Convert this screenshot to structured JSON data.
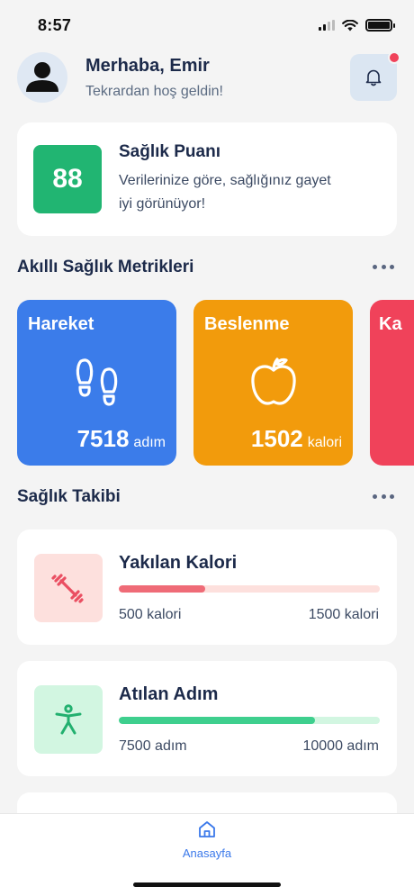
{
  "status_bar": {
    "time": "8:57"
  },
  "header": {
    "greeting": "Merhaba, Emir",
    "subtitle": "Tekrardan hoş geldin!",
    "avatar_icon": "user-icon",
    "notification_icon": "bell-icon",
    "has_notification": true
  },
  "health_score": {
    "value": "88",
    "title": "Sağlık Puanı",
    "description_line1": "Verilerinize göre, sağlığınız gayet",
    "description_line2": "iyi görünüyor!",
    "color": "#21b572"
  },
  "metrics_section": {
    "title": "Akıllı Sağlık Metrikleri",
    "more_icon": "more-horizontal-icon",
    "cards": [
      {
        "title": "Hareket",
        "icon": "footprints-icon",
        "value": "7518",
        "unit": "adım",
        "color": "#3b7cea"
      },
      {
        "title": "Beslenme",
        "icon": "apple-icon",
        "value": "1502",
        "unit": "kalori",
        "color": "#f29b0c"
      },
      {
        "title": "Ka",
        "icon": "",
        "value": "",
        "unit": "",
        "color": "#f0425a"
      }
    ]
  },
  "tracking_section": {
    "title": "Sağlık Takibi",
    "more_icon": "more-horizontal-icon",
    "items": [
      {
        "title": "Yakılan Kalori",
        "icon": "dumbbell-icon",
        "current": "500 kalori",
        "goal": "1500 kalori",
        "progress": 0.33,
        "color": "#ef6b77",
        "track_color": "#fde0dd",
        "icon_bg": "#fde0dd"
      },
      {
        "title": "Atılan Adım",
        "icon": "person-icon",
        "current": "7500 adım",
        "goal": "10000 adım",
        "progress": 0.75,
        "color": "#3ecf8e",
        "track_color": "#d2f6e1",
        "icon_bg": "#d2f6e1"
      }
    ]
  },
  "tab_bar": {
    "items": [
      {
        "label": "Anasayfa",
        "icon": "home-icon",
        "active": true
      }
    ],
    "active_color": "#3a78ea"
  }
}
